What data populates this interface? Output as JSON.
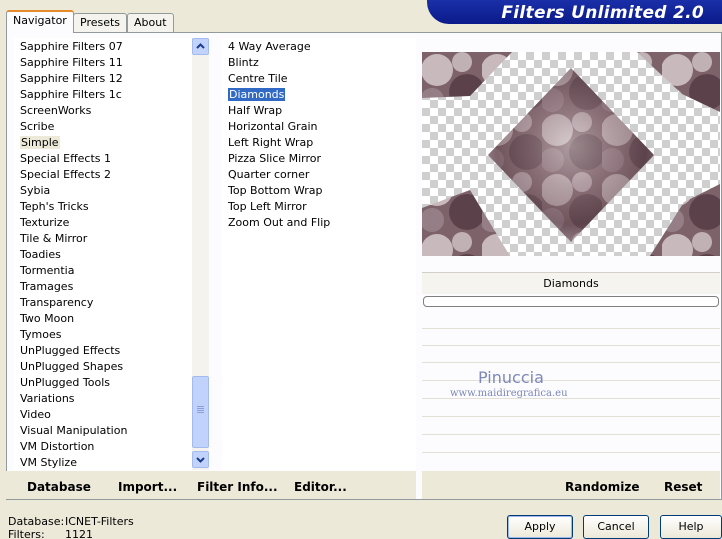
{
  "app_title": "Filters Unlimited 2.0",
  "tabs": [
    "Navigator",
    "Presets",
    "About"
  ],
  "categories": [
    "Sapphire Filters 07",
    "Sapphire Filters 11",
    "Sapphire Filters 12",
    "Sapphire Filters 1c",
    "ScreenWorks",
    "Scribe",
    "Simple",
    "Special Effects 1",
    "Special Effects 2",
    "Sybia",
    "Teph's Tricks",
    "Texturize",
    "Tile & Mirror",
    "Toadies",
    "Tormentia",
    "Tramages",
    "Transparency",
    "Two Moon",
    "Tymoes",
    "UnPlugged Effects",
    "UnPlugged Shapes",
    "UnPlugged Tools",
    "Variations",
    "Video",
    "Visual Manipulation",
    "VM Distortion",
    "VM Stylize"
  ],
  "selected_category": "Simple",
  "filters": [
    "4 Way Average",
    "Blintz",
    "Centre Tile",
    "Diamonds",
    "Half Wrap",
    "Horizontal Grain",
    "Left Right Wrap",
    "Pizza Slice Mirror",
    "Quarter corner",
    "Top Bottom Wrap",
    "Top Left Mirror",
    "Zoom Out and Flip"
  ],
  "selected_filter": "Diamonds",
  "preview": {
    "filter_name": "Diamonds",
    "progress": 0
  },
  "watermark": {
    "name": "Pinuccia",
    "site": "www.maidiregrafica.eu"
  },
  "toolbar": {
    "database": "Database",
    "import": "Import...",
    "filter_info": "Filter Info...",
    "editor": "Editor...",
    "randomize": "Randomize",
    "reset": "Reset"
  },
  "status": {
    "database_label": "Database:",
    "database_value": "ICNET-Filters",
    "filters_label": "Filters:",
    "filters_value": "1121"
  },
  "buttons": {
    "apply": "Apply",
    "cancel": "Cancel",
    "help": "Help"
  },
  "colors": {
    "selection": "#316ac5",
    "banner": "#0a1a8a",
    "scroll_thumb": "#c1d3fb"
  }
}
